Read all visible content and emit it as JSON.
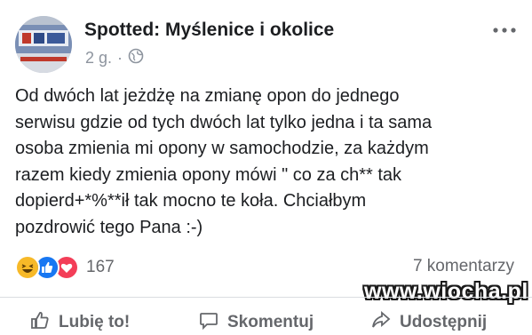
{
  "post": {
    "author": "Spotted: Myślenice i okolice",
    "time": "2 g.",
    "separator": "·",
    "privacy_icon": "globe-icon",
    "more_icon": "more-options-icon",
    "text_lines": [
      "Od dwóch lat jeżdżę na zmianę opon do jednego",
      "serwisu gdzie od tych dwóch lat tylko jedna i ta sama",
      "osoba zmienia mi opony w samochodzie, za każdym",
      "razem kiedy zmienia opony mówi \" co za ch** tak",
      "dopierd+*%**ił tak mocno te koła. Chciałbym",
      "pozdrowić tego Pana :-)"
    ]
  },
  "engagement": {
    "reaction_icons": [
      "haha-icon",
      "like-icon",
      "love-icon"
    ],
    "reaction_count": "167",
    "comments": "7 komentarzy"
  },
  "watermark": "www.wiocha.pl",
  "actions": [
    {
      "icon": "thumbs-up-icon",
      "label": "Lubię to!"
    },
    {
      "icon": "comment-icon",
      "label": "Skomentuj"
    },
    {
      "icon": "share-icon",
      "label": "Udostępnij"
    }
  ],
  "colors": {
    "text": "#1c1e21",
    "secondary": "#65676b",
    "like_blue": "#1877f2",
    "love_red": "#f33e58",
    "haha_yellow": "#f7b928"
  }
}
